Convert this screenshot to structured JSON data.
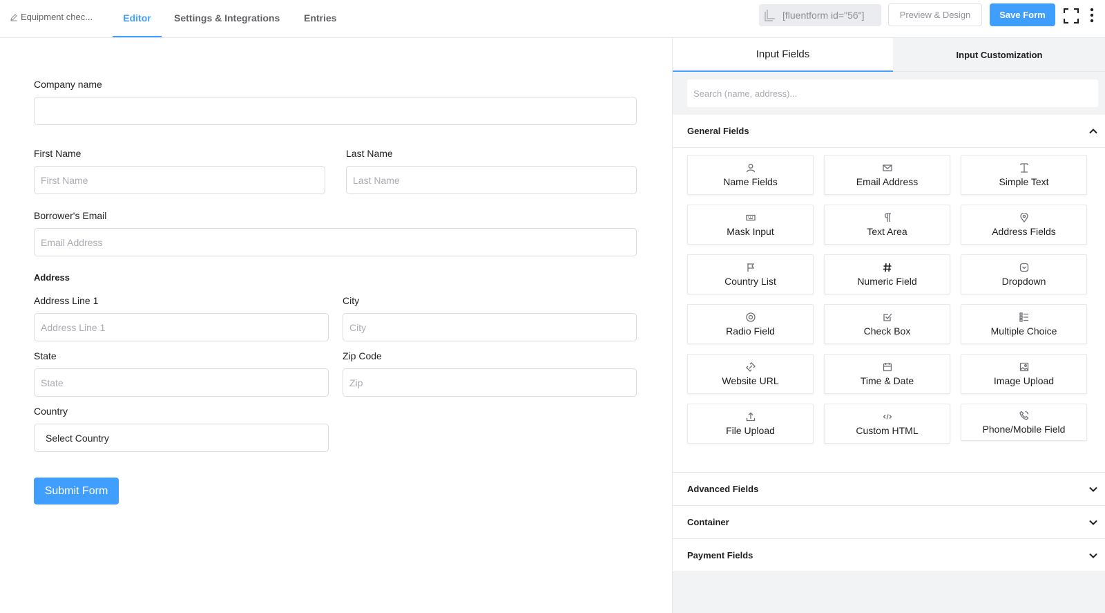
{
  "topbar": {
    "form_title": "Equipment chec...",
    "tabs": [
      {
        "label": "Editor",
        "active": true
      },
      {
        "label": "Settings & Integrations",
        "active": false
      },
      {
        "label": "Entries",
        "active": false
      }
    ],
    "shortcode": "[fluentform id=\"56\"]",
    "preview_label": "Preview & Design",
    "save_label": "Save Form"
  },
  "form": {
    "company": {
      "label": "Company name",
      "placeholder": ""
    },
    "first_name": {
      "label": "First Name",
      "placeholder": "First Name"
    },
    "last_name": {
      "label": "Last Name",
      "placeholder": "Last Name"
    },
    "email": {
      "label": "Borrower's Email",
      "placeholder": "Email Address"
    },
    "address_heading": "Address",
    "address_line1": {
      "label": "Address Line 1",
      "placeholder": "Address Line 1"
    },
    "city": {
      "label": "City",
      "placeholder": "City"
    },
    "state": {
      "label": "State",
      "placeholder": "State"
    },
    "zip": {
      "label": "Zip Code",
      "placeholder": "Zip"
    },
    "country": {
      "label": "Country",
      "value": "Select Country"
    },
    "submit_label": "Submit Form"
  },
  "panel": {
    "tabs": [
      {
        "label": "Input Fields",
        "active": true
      },
      {
        "label": "Input Customization",
        "active": false
      }
    ],
    "search_placeholder": "Search (name, address)...",
    "sections": [
      {
        "title": "General Fields",
        "expanded": true
      },
      {
        "title": "Advanced Fields",
        "expanded": false
      },
      {
        "title": "Container",
        "expanded": false
      },
      {
        "title": "Payment Fields",
        "expanded": false
      }
    ],
    "general_fields": [
      {
        "label": "Name Fields",
        "icon": "user-icon"
      },
      {
        "label": "Email Address",
        "icon": "envelope-icon"
      },
      {
        "label": "Simple Text",
        "icon": "text-cursor-icon"
      },
      {
        "label": "Mask Input",
        "icon": "keyboard-icon"
      },
      {
        "label": "Text Area",
        "icon": "paragraph-icon"
      },
      {
        "label": "Address Fields",
        "icon": "map-pin-icon"
      },
      {
        "label": "Country List",
        "icon": "flag-icon"
      },
      {
        "label": "Numeric Field",
        "icon": "hash-icon"
      },
      {
        "label": "Dropdown",
        "icon": "dropdown-icon"
      },
      {
        "label": "Radio Field",
        "icon": "radio-icon"
      },
      {
        "label": "Check Box",
        "icon": "checkbox-icon"
      },
      {
        "label": "Multiple Choice",
        "icon": "list-icon"
      },
      {
        "label": "Website URL",
        "icon": "link-icon"
      },
      {
        "label": "Time & Date",
        "icon": "calendar-icon"
      },
      {
        "label": "Image Upload",
        "icon": "image-icon"
      },
      {
        "label": "File Upload",
        "icon": "upload-icon"
      },
      {
        "label": "Custom HTML",
        "icon": "code-icon"
      },
      {
        "label": "Phone/Mobile Field",
        "icon": "phone-icon"
      }
    ]
  },
  "colors": {
    "accent": "#409eff",
    "border": "#dadbdd",
    "panel_bg": "#f2f3f5"
  }
}
